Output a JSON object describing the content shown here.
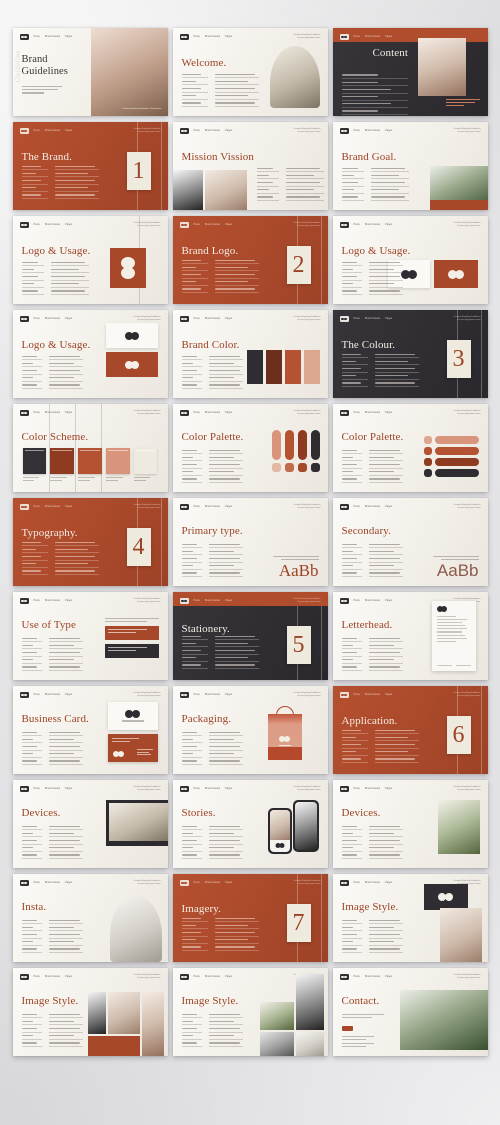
{
  "meta": {
    "product_title": "Brand Guidelines",
    "layout": "3-column presentation template preview grid",
    "slide_count": 30
  },
  "palette": {
    "rust": "#a8482a",
    "rust_light": "#b5502f",
    "terracotta": "#c1573a",
    "salmon": "#dca78f",
    "cream": "#efeade",
    "charcoal": "#2f2d31",
    "paper": "#f4f1eb",
    "backdrop": "#e7e7ea",
    "title_ink": "#9d4325"
  },
  "nav": {
    "logo": "brand-logo-chip",
    "items": [
      "Home",
      "Brand Guides",
      "Pages"
    ],
    "meta_lines": [
      "Creative Branding Guidelines",
      "for your big project name"
    ]
  },
  "slides": [
    {
      "n": 1,
      "title": "Brand Guidelines",
      "theme": "light",
      "kind": "cover"
    },
    {
      "n": 2,
      "title": "Welcome.",
      "theme": "light",
      "kind": "arch-photo"
    },
    {
      "n": 3,
      "title": "Content",
      "theme": "dark",
      "kind": "contents"
    },
    {
      "n": 4,
      "title": "The Brand.",
      "theme": "rust",
      "kind": "divider",
      "numeral": "1"
    },
    {
      "n": 5,
      "title": "Mission Vission",
      "theme": "light",
      "kind": "two-photo"
    },
    {
      "n": 6,
      "title": "Brand Goal.",
      "theme": "light",
      "kind": "photo-right"
    },
    {
      "n": 7,
      "title": "Logo & Usage.",
      "theme": "light",
      "kind": "logo-square"
    },
    {
      "n": 8,
      "title": "Brand Logo.",
      "theme": "rust",
      "kind": "divider",
      "numeral": "2"
    },
    {
      "n": 9,
      "title": "Logo & Usage.",
      "theme": "light",
      "kind": "logo-pair"
    },
    {
      "n": 10,
      "title": "Logo & Usage.",
      "theme": "light",
      "kind": "logo-stack"
    },
    {
      "n": 11,
      "title": "Brand Color.",
      "theme": "light",
      "kind": "color-bars"
    },
    {
      "n": 12,
      "title": "The Colour.",
      "theme": "dark",
      "kind": "divider",
      "numeral": "3"
    },
    {
      "n": 13,
      "title": "Color Scheme.",
      "theme": "light",
      "kind": "swatch-cards"
    },
    {
      "n": 14,
      "title": "Color Palette.",
      "theme": "light",
      "kind": "vials"
    },
    {
      "n": 15,
      "title": "Color Palette.",
      "theme": "light",
      "kind": "pills"
    },
    {
      "n": 16,
      "title": "Typography.",
      "theme": "rust",
      "kind": "divider",
      "numeral": "4"
    },
    {
      "n": 17,
      "title": "Primary type.",
      "theme": "light",
      "kind": "specimen-serif",
      "specimen": "AaBb"
    },
    {
      "n": 18,
      "title": "Secondary.",
      "theme": "light",
      "kind": "specimen-sans",
      "specimen": "AaBb"
    },
    {
      "n": 19,
      "title": "Use of Type",
      "theme": "light",
      "kind": "use-of-type"
    },
    {
      "n": 20,
      "title": "Stationery.",
      "theme": "dark",
      "kind": "divider",
      "numeral": "5"
    },
    {
      "n": 21,
      "title": "Letterhead.",
      "theme": "light",
      "kind": "letterhead"
    },
    {
      "n": 22,
      "title": "Business Card.",
      "theme": "light",
      "kind": "business-card"
    },
    {
      "n": 23,
      "title": "Packaging.",
      "theme": "light",
      "kind": "packaging"
    },
    {
      "n": 24,
      "title": "Application.",
      "theme": "rust",
      "kind": "divider",
      "numeral": "6"
    },
    {
      "n": 25,
      "title": "Devices.",
      "theme": "light",
      "kind": "laptop"
    },
    {
      "n": 26,
      "title": "Stories.",
      "theme": "light",
      "kind": "phones"
    },
    {
      "n": 27,
      "title": "Devices.",
      "theme": "light",
      "kind": "product-photo"
    },
    {
      "n": 28,
      "title": "Insta.",
      "theme": "light",
      "kind": "arch-photo2"
    },
    {
      "n": 29,
      "title": "Imagery.",
      "theme": "rust",
      "kind": "divider",
      "numeral": "7"
    },
    {
      "n": 30,
      "title": "Image Style.",
      "theme": "light",
      "kind": "image-style-a"
    },
    {
      "n": 31,
      "title": "Image Style.",
      "theme": "light",
      "kind": "image-style-b"
    },
    {
      "n": 32,
      "title": "Image Style.",
      "theme": "light",
      "kind": "image-style-c"
    },
    {
      "n": 33,
      "title": "Contact.",
      "theme": "light",
      "kind": "contact"
    }
  ],
  "cover": {
    "side_text": "Guideline",
    "body_lines": [
      "Creative Branding",
      "Guidelines for your big",
      "project name"
    ],
    "footer": "Creative Branding Guidelines Presentation"
  },
  "color_scheme": {
    "swatches": [
      "#343136",
      "#8e3b21",
      "#b55232",
      "#d9957c",
      "#efeae0"
    ]
  },
  "color_palette_vials": {
    "tubes": [
      "#d9957c",
      "#b55232",
      "#8e3b21",
      "#2f2d31"
    ],
    "dots": [
      "#e3b8a3",
      "#c06b4b",
      "#a44a2b",
      "#2f2d31"
    ]
  },
  "color_palette_pills": {
    "rows": [
      {
        "small": "#dca78f",
        "large": "#d9957c"
      },
      {
        "small": "#b55232",
        "large": "#b55232"
      },
      {
        "small": "#8e3b21",
        "large": "#8e3b21"
      },
      {
        "small": "#2f2d31",
        "large": "#2f2d31"
      }
    ]
  },
  "color_bars": {
    "values": [
      "#2f2d31",
      "#6b2f1c",
      "#b55232",
      "#dca78f"
    ]
  },
  "contents_rows": 6
}
